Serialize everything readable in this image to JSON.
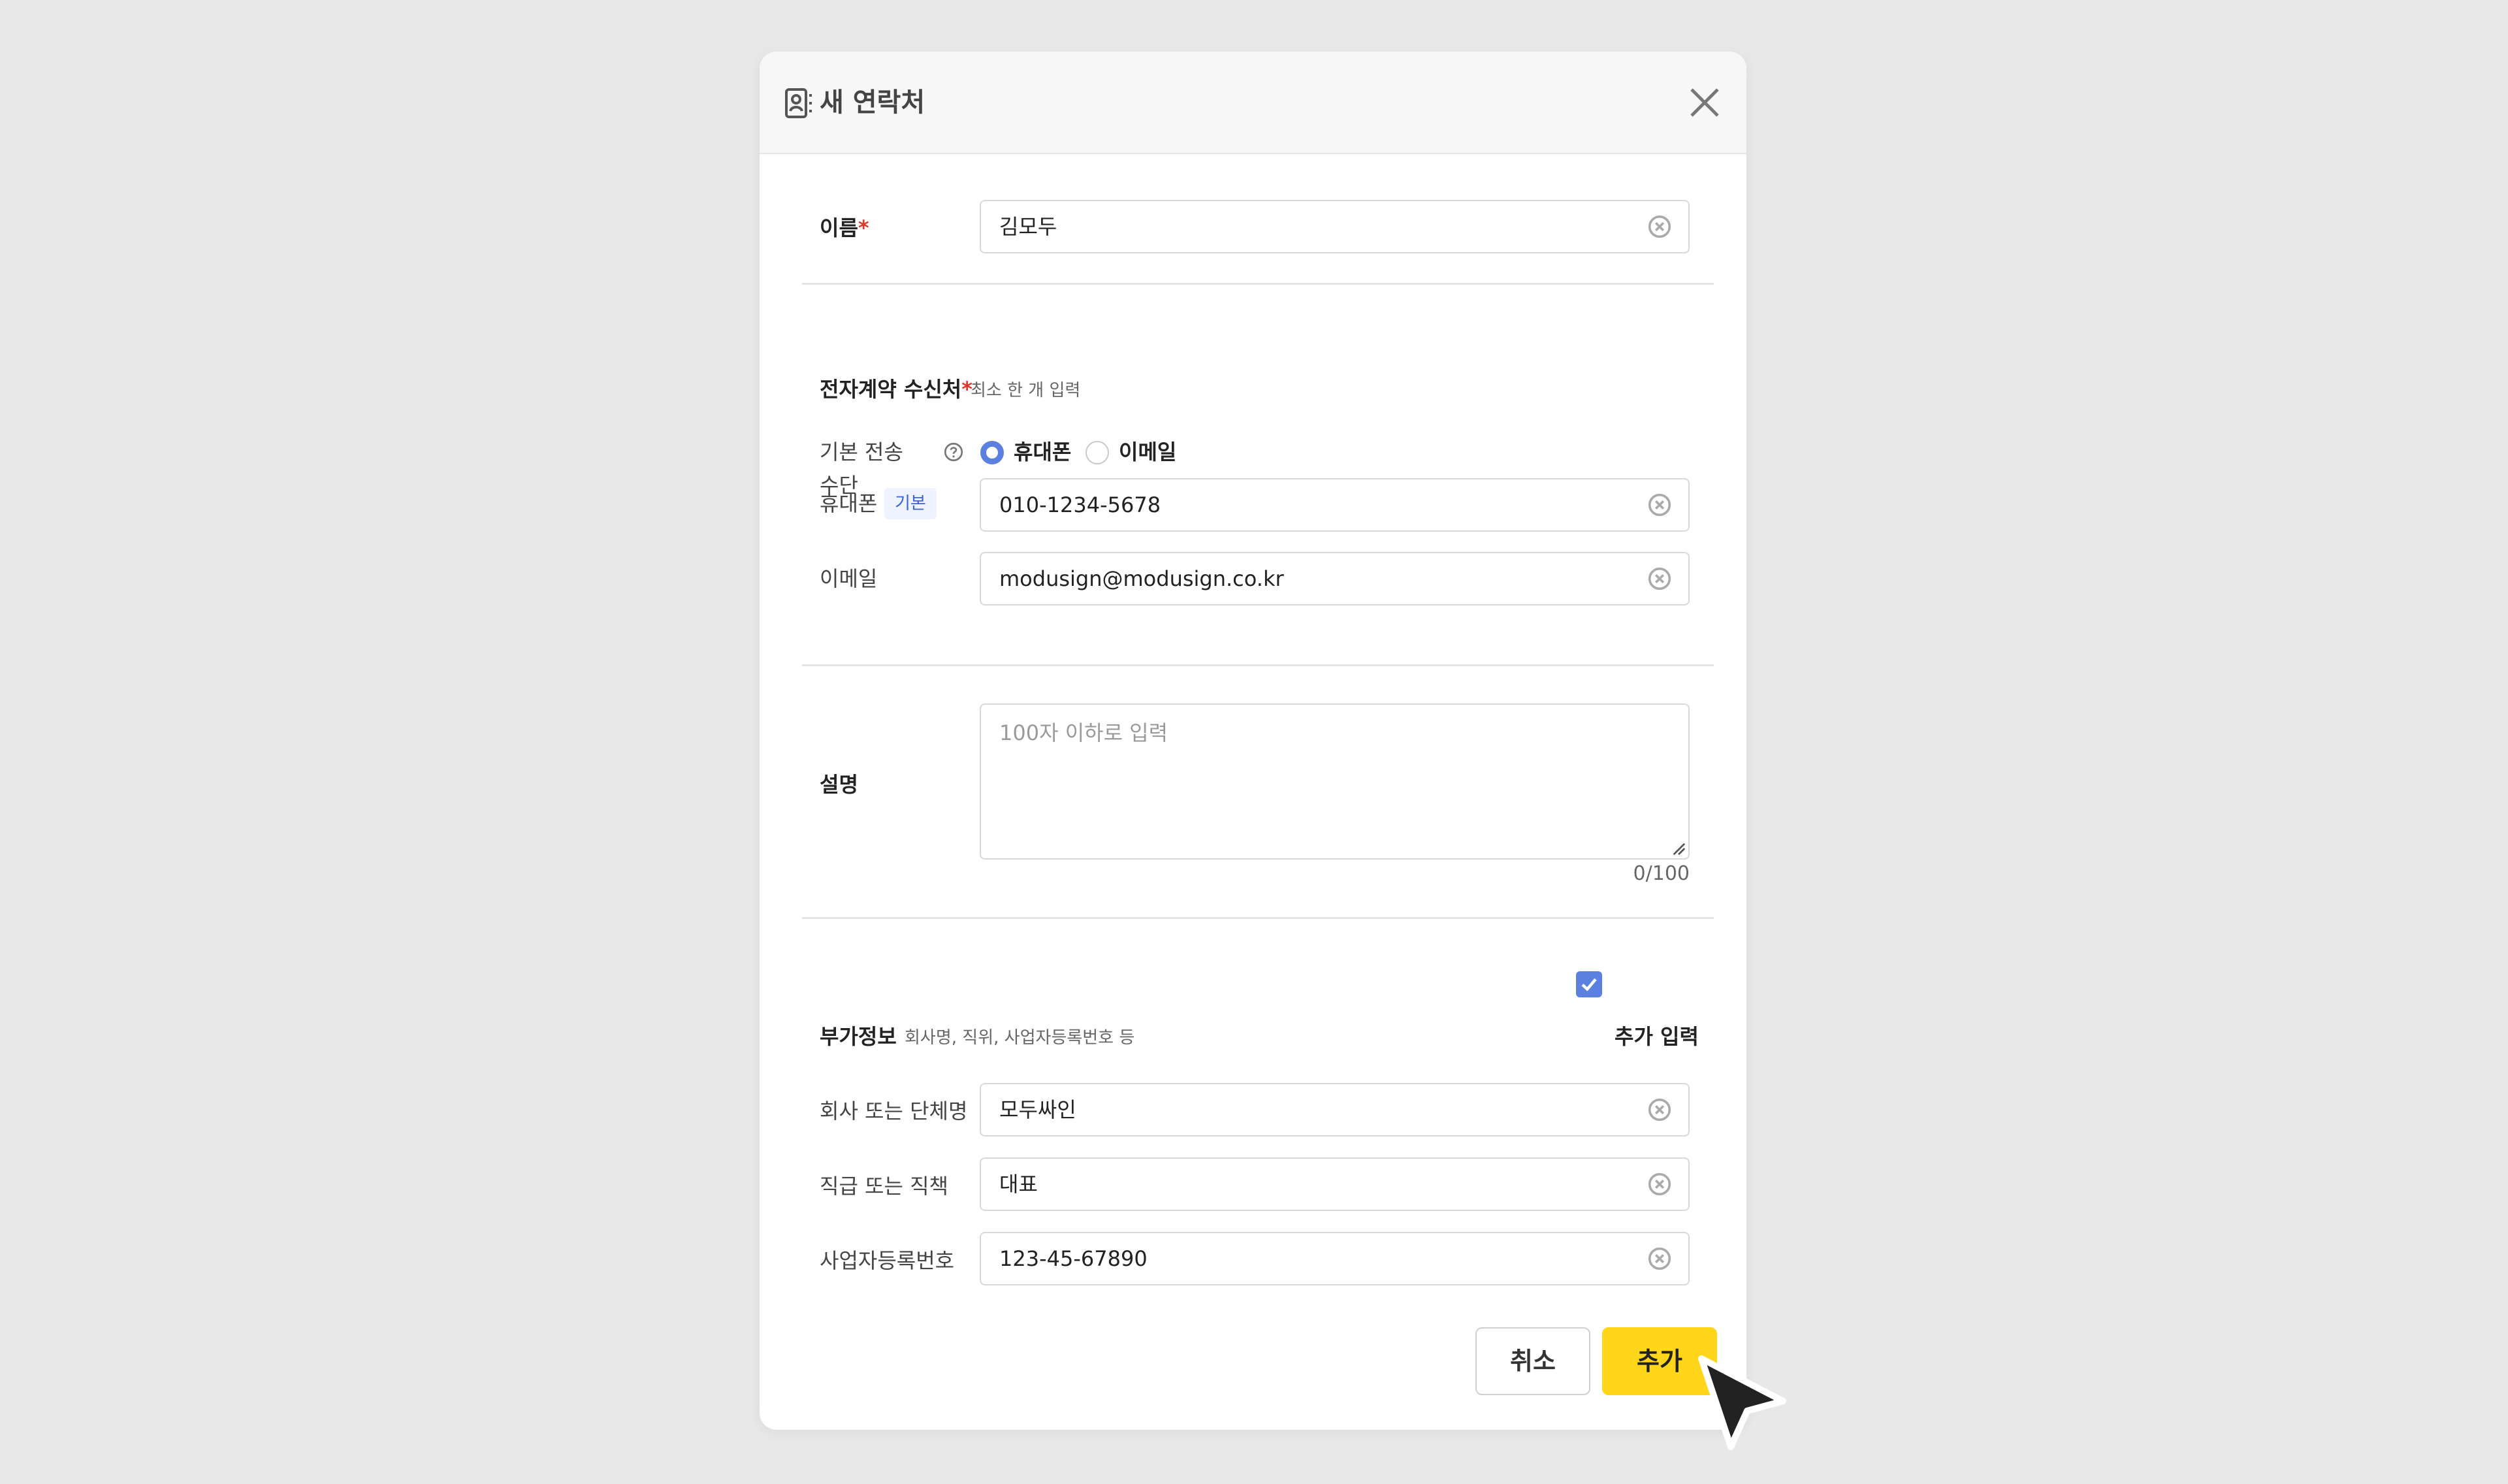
{
  "dialog": {
    "title": "새 연락처",
    "header_icon": "contact-book-icon",
    "close_icon": "close-icon"
  },
  "name": {
    "label": "이름",
    "required_mark": "*",
    "value": "김모두"
  },
  "recipient": {
    "section_label": "전자계약 수신처",
    "required_mark": "*",
    "hint": "최소 한 개 입력",
    "default_method_label_line1": "기본 전송",
    "default_method_label_line2": "수단",
    "help_icon": "help-icon",
    "options": [
      {
        "label": "휴대폰",
        "selected": true
      },
      {
        "label": "이메일",
        "selected": false
      }
    ],
    "phone_label": "휴대폰",
    "phone_badge": "기본",
    "phone_value": "010-1234-5678",
    "email_label": "이메일",
    "email_value": "modusign@modusign.co.kr"
  },
  "description": {
    "label": "설명",
    "placeholder": "100자 이하로 입력",
    "counter": "0/100"
  },
  "extra": {
    "section_label": "부가정보",
    "hint": "회사명, 직위, 사업자등록번호 등",
    "checkbox_label": "추가 입력",
    "checked": true,
    "company_label": "회사 또는 단체명",
    "company_value": "모두싸인",
    "position_label": "직급 또는 직책",
    "position_value": "대표",
    "bizno_label": "사업자등록번호",
    "bizno_value": "123-45-67890"
  },
  "buttons": {
    "cancel": "취소",
    "add": "추가"
  },
  "colors": {
    "accent_blue": "#5b80e0",
    "add_button": "#ffd619",
    "required": "#e0382b",
    "background": "#e8e8e8"
  }
}
